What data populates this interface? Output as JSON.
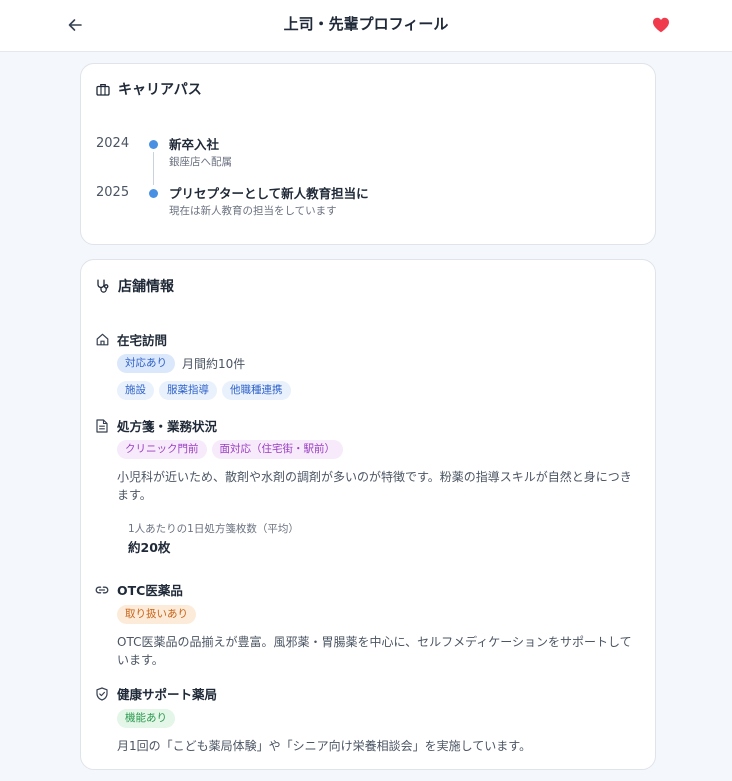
{
  "header": {
    "title": "上司・先輩プロフィール",
    "back_icon": "arrow-left-icon",
    "favorite_icon": "heart-icon",
    "favorite_color": "#ef3b4c"
  },
  "career": {
    "title": "キャリアパス",
    "icon": "briefcase-icon",
    "items": [
      {
        "year": "2024",
        "title": "新卒入社",
        "subtitle": "銀座店へ配属"
      },
      {
        "year": "2025",
        "title": "プリセプターとして新人教育担当に",
        "subtitle": "現在は新人教育の担当をしています"
      }
    ]
  },
  "store": {
    "title": "店舗情報",
    "icon": "stethoscope-icon",
    "home_visit": {
      "title": "在宅訪問",
      "icon": "home-icon",
      "status": "対応あり",
      "note": "月間約10件",
      "tags": [
        "施設",
        "服薬指導",
        "他職種連携"
      ]
    },
    "prescription": {
      "title": "処方箋・業務状況",
      "icon": "document-icon",
      "tags": [
        "クリニック門前",
        "面対応（住宅街・駅前）"
      ],
      "description": "小児科が近いため、散剤や水剤の調剤が多いのが特徴です。粉薬の指導スキルが自然と身につきます。",
      "stat_label": "1人あたりの1日処方箋枚数（平均）",
      "stat_value": "約20枚"
    },
    "otc": {
      "title": "OTC医薬品",
      "icon": "link-icon",
      "status": "取り扱いあり",
      "description": "OTC医薬品の品揃えが豊富。風邪薬・胃腸薬を中心に、セルフメディケーションをサポートしています。"
    },
    "health": {
      "title": "健康サポート薬局",
      "icon": "shield-check-icon",
      "status": "機能あり",
      "description": "月1回の「こども薬局体験」や「シニア向け栄養相談会」を実施しています。"
    }
  }
}
